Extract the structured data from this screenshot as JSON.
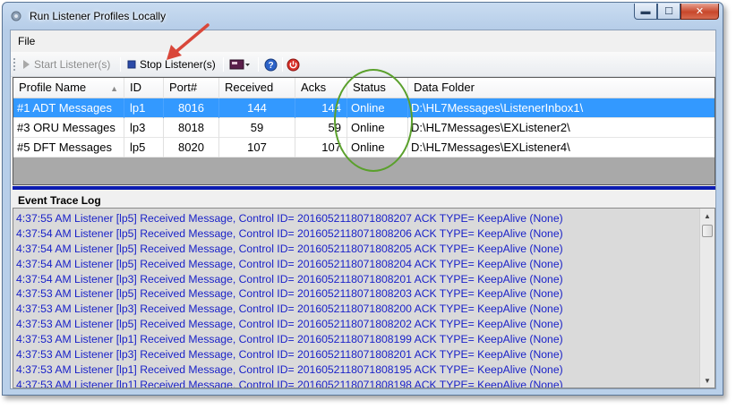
{
  "window": {
    "title": "Run Listener Profiles Locally"
  },
  "caption": {
    "minimize": "▬",
    "maximize": "☐",
    "close": "✕"
  },
  "menu": {
    "file": "File"
  },
  "toolbar": {
    "start_label": "Start Listener(s)",
    "stop_label": "Stop Listener(s)"
  },
  "grid": {
    "columns": [
      "Profile Name",
      "ID",
      "Port#",
      "Received",
      "Acks",
      "Status",
      "Data Folder"
    ],
    "rows": [
      {
        "profile": "#1 ADT Messages",
        "id": "lp1",
        "port": "8016",
        "received": "144",
        "acks": "144",
        "status": "Online",
        "folder": "D:\\HL7Messages\\ListenerInbox1\\",
        "selected": true
      },
      {
        "profile": "#3 ORU Messages",
        "id": "lp3",
        "port": "8018",
        "received": "59",
        "acks": "59",
        "status": "Online",
        "folder": "D:\\HL7Messages\\EXListener2\\",
        "selected": false
      },
      {
        "profile": "#5 DFT Messages",
        "id": "lp5",
        "port": "8020",
        "received": "107",
        "acks": "107",
        "status": "Online",
        "folder": "D:\\HL7Messages\\EXListener4\\",
        "selected": false
      }
    ]
  },
  "log": {
    "label": "Event Trace Log",
    "lines": [
      "4:37:55 AM Listener [lp5] Received Message, Control ID= 2016052118071808207 ACK TYPE= KeepAlive (None)",
      "4:37:54 AM Listener [lp5] Received Message, Control ID= 2016052118071808206 ACK TYPE= KeepAlive (None)",
      "4:37:54 AM Listener [lp5] Received Message, Control ID= 2016052118071808205 ACK TYPE= KeepAlive (None)",
      "4:37:54 AM Listener [lp5] Received Message, Control ID= 2016052118071808204 ACK TYPE= KeepAlive (None)",
      "4:37:54 AM Listener [lp3] Received Message, Control ID= 2016052118071808201 ACK TYPE= KeepAlive (None)",
      "4:37:53 AM Listener [lp5] Received Message, Control ID= 2016052118071808203 ACK TYPE= KeepAlive (None)",
      "4:37:53 AM Listener [lp3] Received Message, Control ID= 2016052118071808200 ACK TYPE= KeepAlive (None)",
      "4:37:53 AM Listener [lp5] Received Message, Control ID= 2016052118071808202 ACK TYPE= KeepAlive (None)",
      "4:37:53 AM Listener [lp1] Received Message, Control ID= 2016052118071808199 ACK TYPE= KeepAlive (None)",
      "4:37:53 AM Listener [lp3] Received Message, Control ID= 2016052118071808201 ACK TYPE= KeepAlive (None)",
      "4:37:53 AM Listener [lp1] Received Message, Control ID= 2016052118071808195 ACK TYPE= KeepAlive (None)",
      "4:37:53 AM Listener [lp1] Received Message, Control ID= 2016052118071808198 ACK TYPE= KeepAlive (None)"
    ]
  },
  "colors": {
    "selection": "#3399ff",
    "log_text": "#1a22c8",
    "splitter": "#0a1bb0",
    "annotation_arrow": "#d9473a",
    "annotation_circle": "#5aa02c"
  },
  "icons": {
    "app": "gear-icon",
    "start": "play-icon",
    "stop": "stop-square-icon",
    "view": "window-dropdown-icon",
    "help": "help-icon",
    "power": "power-icon"
  }
}
